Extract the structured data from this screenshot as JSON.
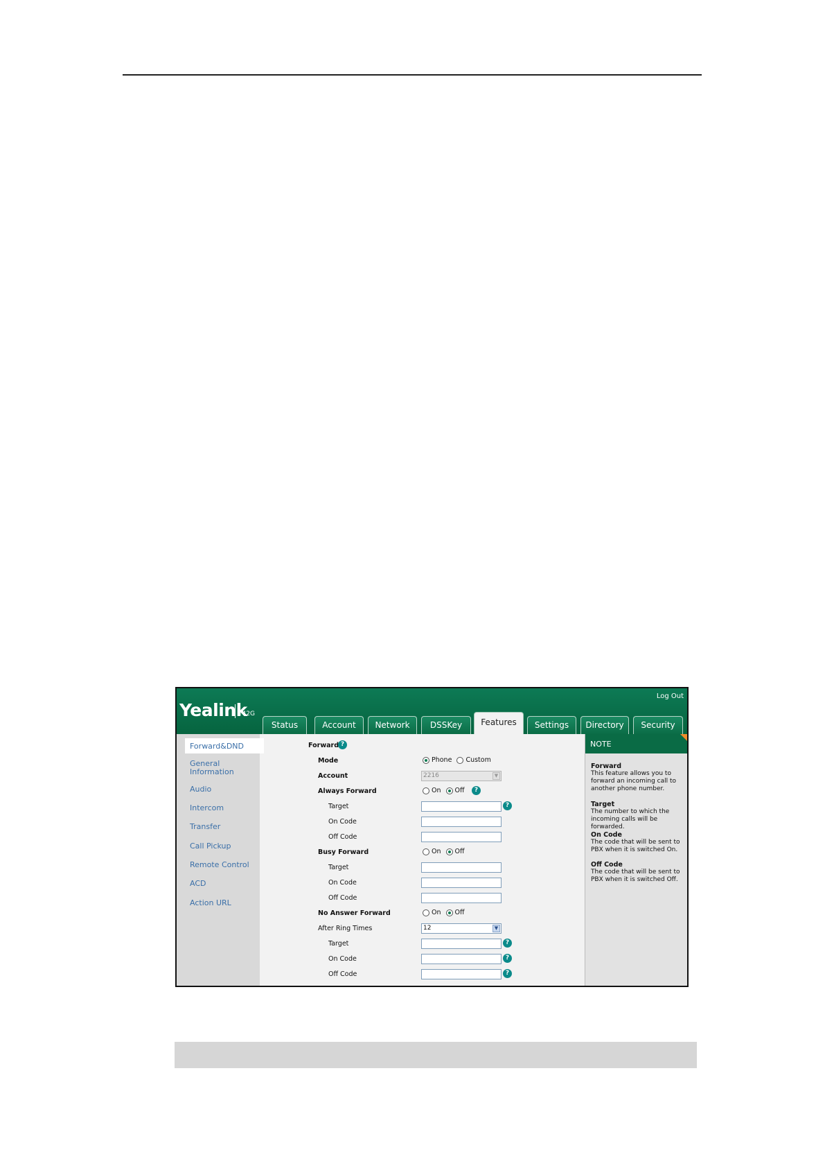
{
  "app": {
    "logo": "Yealink",
    "model": "T42G",
    "logout": "Log Out"
  },
  "tabs": [
    {
      "label": "Status"
    },
    {
      "label": "Account"
    },
    {
      "label": "Network"
    },
    {
      "label": "DSSKey"
    },
    {
      "label": "Features",
      "active": true
    },
    {
      "label": "Settings"
    },
    {
      "label": "Directory"
    },
    {
      "label": "Security"
    }
  ],
  "sidebar": {
    "items": [
      {
        "label": "Forward&DND",
        "active": true
      },
      {
        "label": "General Information"
      },
      {
        "label": "Audio"
      },
      {
        "label": "Intercom"
      },
      {
        "label": "Transfer"
      },
      {
        "label": "Call Pickup"
      },
      {
        "label": "Remote Control"
      },
      {
        "label": "ACD"
      },
      {
        "label": "Action URL"
      }
    ]
  },
  "form": {
    "section_title": "Forward",
    "mode_label": "Mode",
    "mode_options": {
      "phone": "Phone",
      "custom": "Custom",
      "selected": "Phone"
    },
    "account_label": "Account",
    "account_value": "2216",
    "always_forward_label": "Always Forward",
    "busy_forward_label": "Busy Forward",
    "no_answer_forward_label": "No Answer Forward",
    "after_ring_times_label": "After Ring Times",
    "after_ring_times_value": "12",
    "target_label": "Target",
    "on_code_label": "On Code",
    "off_code_label": "Off Code",
    "on_label": "On",
    "off_label": "Off",
    "always_forward_state": "Off",
    "busy_forward_state": "Off",
    "no_answer_forward_state": "Off",
    "help_glyph": "?"
  },
  "note": {
    "header": "NOTE",
    "entries": [
      {
        "title": "Forward",
        "text": "This feature allows you to forward an incoming call to another phone number."
      },
      {
        "title": "Target",
        "text": "The number to which the incoming calls will be forwarded."
      },
      {
        "title": "On Code",
        "text": "The code that will be sent to PBX when it is switched On."
      },
      {
        "title": "Off Code",
        "text": "The code that will be sent to PBX when it is switched Off."
      }
    ]
  },
  "colors": {
    "header_green": "#06643f",
    "nav_link": "#3a6fa8",
    "help_icon": "#0a8a8a",
    "note_corner": "#f08c2b"
  }
}
